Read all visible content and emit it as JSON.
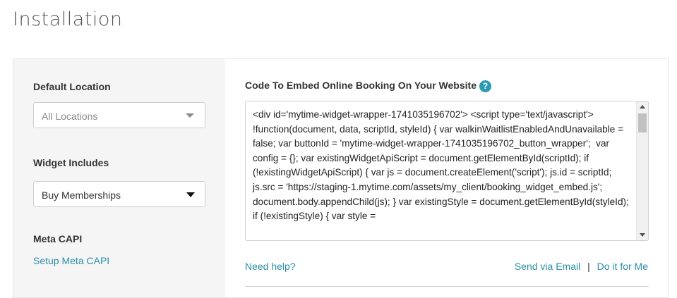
{
  "page": {
    "title": "Installation"
  },
  "sidebar": {
    "default_location_label": "Default Location",
    "location_select_placeholder": "All Locations",
    "widget_includes_label": "Widget Includes",
    "widget_select_value": "Buy Memberships",
    "meta_capi_label": "Meta CAPI",
    "meta_capi_link": "Setup Meta CAPI"
  },
  "main": {
    "code_heading": "Code To Embed Online Booking On Your Website",
    "help_icon_glyph": "?",
    "code": "<div id='mytime-widget-wrapper-1741035196702'> <script type='text/javascript'> !function(document, data, scriptId, styleId) { var walkinWaitlistEnabledAndUnavailable = false; var buttonId = 'mytime-widget-wrapper-1741035196702_button_wrapper';  var config = {}; var existingWidgetApiScript = document.getElementById(scriptId); if (!existingWidgetApiScript) { var js = document.createElement('script'); js.id = scriptId; js.src = 'https://staging-1.mytime.com/assets/my_client/booking_widget_embed.js'; document.body.appendChild(js); } var existingStyle = document.getElementById(styleId); if (!existingStyle) { var style =",
    "need_help_link": "Need help?",
    "send_email_link": "Send via Email",
    "separator": "|",
    "do_it_link": "Do it for Me"
  }
}
